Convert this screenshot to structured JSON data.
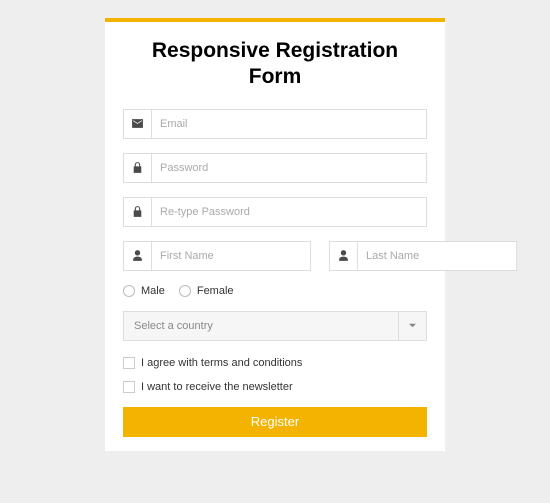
{
  "title": "Responsive Registration Form",
  "fields": {
    "email": {
      "placeholder": "Email"
    },
    "password": {
      "placeholder": "Password"
    },
    "password2": {
      "placeholder": "Re-type Password"
    },
    "firstName": {
      "placeholder": "First Name"
    },
    "lastName": {
      "placeholder": "Last Name"
    }
  },
  "gender": {
    "male": "Male",
    "female": "Female"
  },
  "country": {
    "placeholder": "Select a country"
  },
  "checks": {
    "terms": "I agree with terms and conditions",
    "newsletter": "I want to receive the newsletter"
  },
  "submit": "Register"
}
